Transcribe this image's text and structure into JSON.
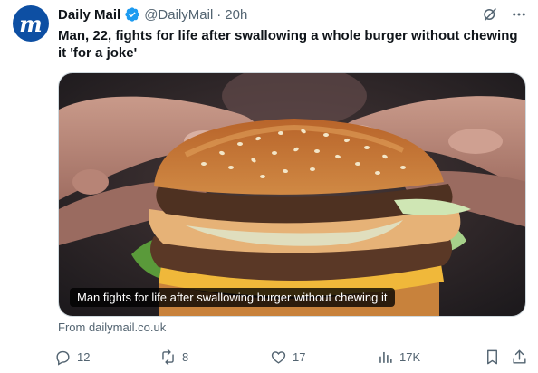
{
  "tweet": {
    "author_name": "Daily Mail",
    "author_handle": "@DailyMail",
    "separator": "·",
    "time": "20h",
    "avatar_letter": "m",
    "text": "Man, 22, fights for life after swallowing a whole burger without chewing it 'for a joke'",
    "media_caption": "Man fights for life after swallowing burger without chewing it",
    "source": "From dailymail.co.uk"
  },
  "actions": {
    "replies": "12",
    "reposts": "8",
    "likes": "17",
    "views": "17K"
  },
  "colors": {
    "avatar_bg": "#0d4fa3",
    "verified": "#1d9bf0",
    "muted_text": "#536471"
  }
}
